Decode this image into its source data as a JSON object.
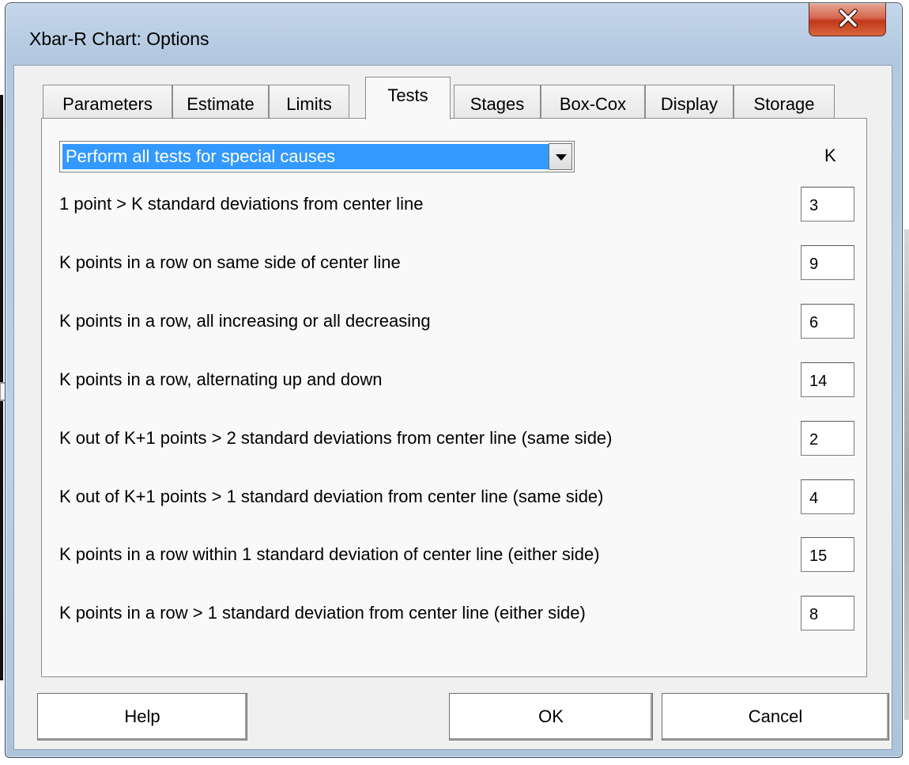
{
  "window": {
    "title": "Xbar-R Chart: Options",
    "close_icon": "close-icon"
  },
  "tabs": [
    {
      "label": "Parameters",
      "active": false
    },
    {
      "label": "Estimate",
      "active": false
    },
    {
      "label": "Limits",
      "active": false
    },
    {
      "label": "Tests",
      "active": true
    },
    {
      "label": "Stages",
      "active": false
    },
    {
      "label": "Box-Cox",
      "active": false
    },
    {
      "label": "Display",
      "active": false
    },
    {
      "label": "Storage",
      "active": false
    }
  ],
  "tests": {
    "mode_select": {
      "selected": "Perform all tests for special causes",
      "icon": "chevron-down-icon"
    },
    "k_header": "K",
    "rows": [
      {
        "label": "1 point > K standard deviations from center line",
        "k": "3"
      },
      {
        "label": "K points in a row on same side of center line",
        "k": "9"
      },
      {
        "label": "K points in a row, all increasing or all decreasing",
        "k": "6"
      },
      {
        "label": "K points in a row, alternating up and down",
        "k": "14"
      },
      {
        "label": "K out of K+1 points > 2 standard deviations from center line (same side)",
        "k": "2"
      },
      {
        "label": "K out of K+1 points > 1 standard deviation from center line (same side)",
        "k": "4"
      },
      {
        "label": "K points in a row within 1 standard deviation of center line (either side)",
        "k": "15"
      },
      {
        "label": "K points in a row > 1 standard deviation from center line (either side)",
        "k": "8"
      }
    ]
  },
  "buttons": {
    "help": "Help",
    "ok": "OK",
    "cancel": "Cancel"
  },
  "colors": {
    "selection": "#3399ff",
    "close_button": "#c2381a",
    "frame": "#b9cde4"
  }
}
